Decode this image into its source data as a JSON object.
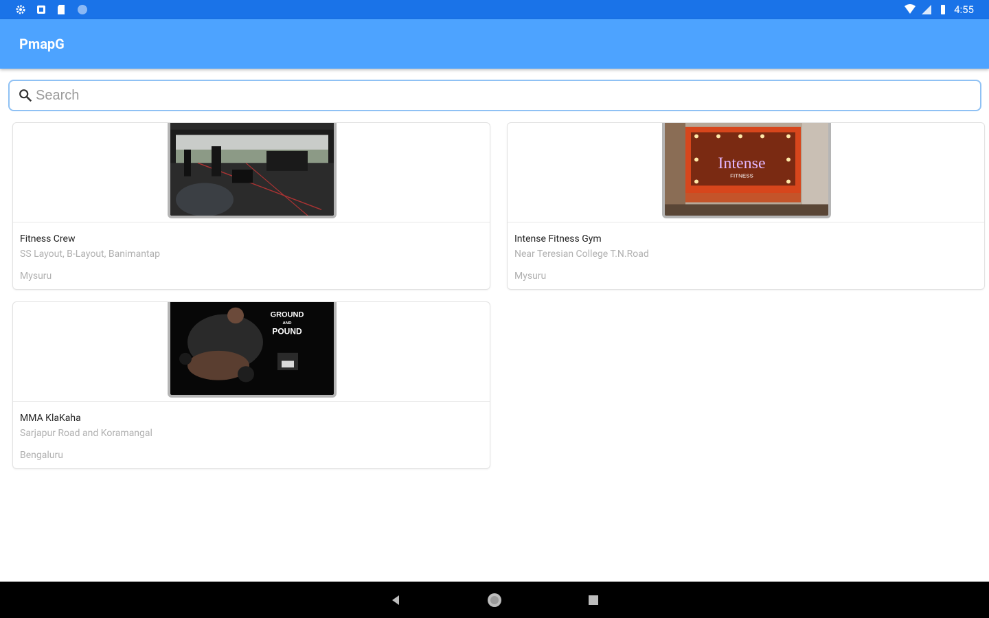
{
  "status_bar": {
    "time": "4:55",
    "left_icons": [
      "settings-icon",
      "sd-card-icon",
      "clipboard-icon",
      "circle-icon"
    ],
    "right_icons": [
      "wifi-icon",
      "signal-icon",
      "battery-icon"
    ]
  },
  "app_bar": {
    "title": "PmapG"
  },
  "search": {
    "placeholder": "Search",
    "value": ""
  },
  "gyms": [
    {
      "name": "Fitness Crew",
      "address": "SS Layout, B-Layout, Banimantap",
      "city": "Mysuru",
      "image": "gym-floor-photo"
    },
    {
      "name": "Intense Fitness Gym",
      "address": "Near Teresian College T.N.Road",
      "city": "Mysuru",
      "image": "intense-fitness-sign-photo"
    },
    {
      "name": "MMA KlaKaha",
      "address": "Sarjapur Road and Koramangal",
      "city": "Bengaluru",
      "image": "ground-and-pound-photo",
      "image_text": [
        "GROUND",
        "AND",
        "POUND"
      ]
    }
  ],
  "image_text": {
    "intense_title": "Intense",
    "intense_sub": "FITNESS"
  },
  "nav": [
    "back-icon",
    "home-icon",
    "recents-icon"
  ]
}
